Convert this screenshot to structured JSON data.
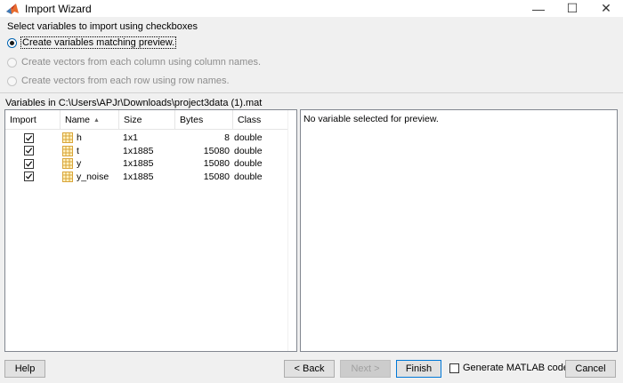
{
  "window": {
    "title": "Import Wizard",
    "minimize_glyph": "—",
    "maximize_glyph": "☐",
    "close_glyph": "✕"
  },
  "options": {
    "label": "Select variables to import using checkboxes",
    "radios": [
      {
        "label": "Create variables matching preview.",
        "selected": true,
        "enabled": true
      },
      {
        "label": "Create vectors from each column using column names.",
        "selected": false,
        "enabled": false
      },
      {
        "label": "Create vectors from each row using row names.",
        "selected": false,
        "enabled": false
      }
    ]
  },
  "variables": {
    "location_label": "Variables in C:\\Users\\APJr\\Downloads\\project3data (1).mat",
    "columns": [
      "Import",
      "Name",
      "Size",
      "Bytes",
      "Class"
    ],
    "sort_indicator": "▲",
    "rows": [
      {
        "checked": true,
        "name": "h",
        "size": "1x1",
        "bytes": "8",
        "class": "double"
      },
      {
        "checked": true,
        "name": "t",
        "size": "1x1885",
        "bytes": "15080",
        "class": "double"
      },
      {
        "checked": true,
        "name": "y",
        "size": "1x1885",
        "bytes": "15080",
        "class": "double"
      },
      {
        "checked": true,
        "name": "y_noise",
        "size": "1x1885",
        "bytes": "15080",
        "class": "double"
      }
    ]
  },
  "preview": {
    "message": "No variable selected for preview."
  },
  "footer": {
    "help": "Help",
    "back": "< Back",
    "next": "Next >",
    "finish": "Finish",
    "generate": "Generate MATLAB code",
    "generate_checked": false,
    "cancel": "Cancel"
  },
  "colors": {
    "accent": "#0078d7",
    "icon_grid": "#d9a53a",
    "icon_fill": "#fff3c4"
  }
}
